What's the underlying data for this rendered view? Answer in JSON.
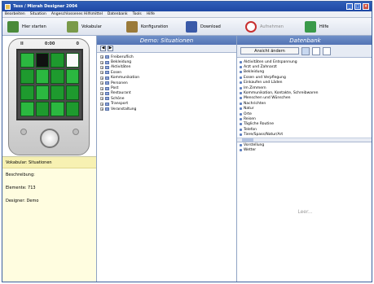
{
  "window": {
    "title": "Tess / Mizrah Designer 2004"
  },
  "menu": [
    "Bearbeiten",
    "Situation",
    "Angeschlossenes Hilfsmittel",
    "Datenbank",
    "Tools",
    "Hilfe"
  ],
  "toolbar": {
    "buttons": [
      {
        "label": "Hier starten",
        "icon": "start-icon",
        "color": "#4a8a3a",
        "enabled": true
      },
      {
        "label": "Vokabular",
        "icon": "vocabulary-icon",
        "color": "#7a9a4a",
        "enabled": true
      },
      {
        "label": "Konfiguration",
        "icon": "configuration-icon",
        "color": "#9a7a3a",
        "enabled": true
      },
      {
        "label": "Download",
        "icon": "download-icon",
        "color": "#3a5aa8",
        "enabled": true
      },
      {
        "label": "Aufnehmen",
        "icon": "record-icon",
        "color": "#c83030",
        "enabled": false
      },
      {
        "label": "Hilfe",
        "icon": "help-icon",
        "color": "#3a9a4a",
        "enabled": true
      }
    ]
  },
  "device": {
    "top_left_label": "II",
    "top_mid_label": "0:00",
    "top_right_label": "0"
  },
  "info": {
    "vocabulary": "Vokabular: Situationen",
    "description": "Beschreibung:",
    "elements": "Elemente: 713",
    "designer": "Designer: Demo"
  },
  "middle": {
    "title": "Demo: Situationen",
    "tree": [
      "Freiberuflich",
      "Bekleidung",
      "Aktivitäten",
      "Essen",
      "Kommunikation",
      "Personen",
      "Post",
      "Restaurant",
      "Schöne",
      "Transport",
      "Veranstaltung"
    ]
  },
  "right": {
    "title": "Datenbank",
    "search_label": "Ansicht ändern",
    "items": [
      "Aktivitäten und Entspannung",
      "Arzt und Zahnarzt",
      "Bekleidung",
      "Essen und Verpflegung",
      "Einkaufen und Läden",
      "Im Zimmern",
      "Kommunikation, Kontakte, Schreibwaren",
      "Menschen und Wünschen",
      "Nachrichten",
      "Natur",
      "Orte",
      "Reisen",
      "Tägliche Routine",
      "Telefon",
      "Tiere/Spass/Natur/Art",
      "Verkehr",
      "Vorstellung",
      "Wetter"
    ],
    "empty_text": "Leer..."
  }
}
